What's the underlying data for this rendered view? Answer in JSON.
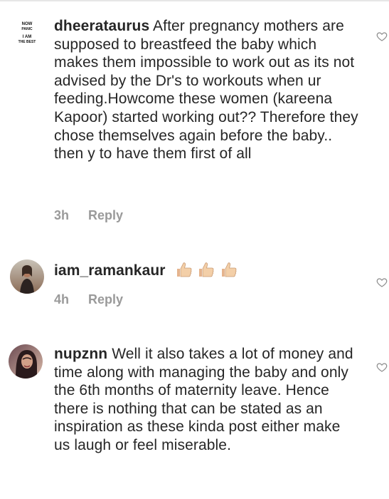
{
  "comments": [
    {
      "username": "dheerataurus",
      "text": "After pregnancy mothers are supposed to breastfeed the baby which makes them impossible to work out as its not advised by the Dr's to workouts when ur feeding.Howcome these women (kareena Kapoor) started working out?? Therefore they chose themselves again before the baby.. then y to have them first of all",
      "avatar_text": [
        "NOW",
        "PANIC",
        "I AM",
        "THE BEST"
      ],
      "time": "3h",
      "reply_label": "Reply"
    },
    {
      "username": "iam_ramankaur",
      "text": "",
      "emoji": "thumbs-up-icon x3",
      "time": "4h",
      "reply_label": "Reply"
    },
    {
      "username": "nupznn",
      "text": "Well it also takes a lot of money and time along with managing the baby and only the 6th months of maternity leave. Hence there is nothing that can be stated as an inspiration as these kinda post either make us laugh or feel miserable.",
      "time": "",
      "reply_label": ""
    }
  ],
  "colors": {
    "text": "#262626",
    "meta": "#9a9a9a",
    "heart": "#8e8e8e",
    "divider": "#e6e6e6"
  }
}
